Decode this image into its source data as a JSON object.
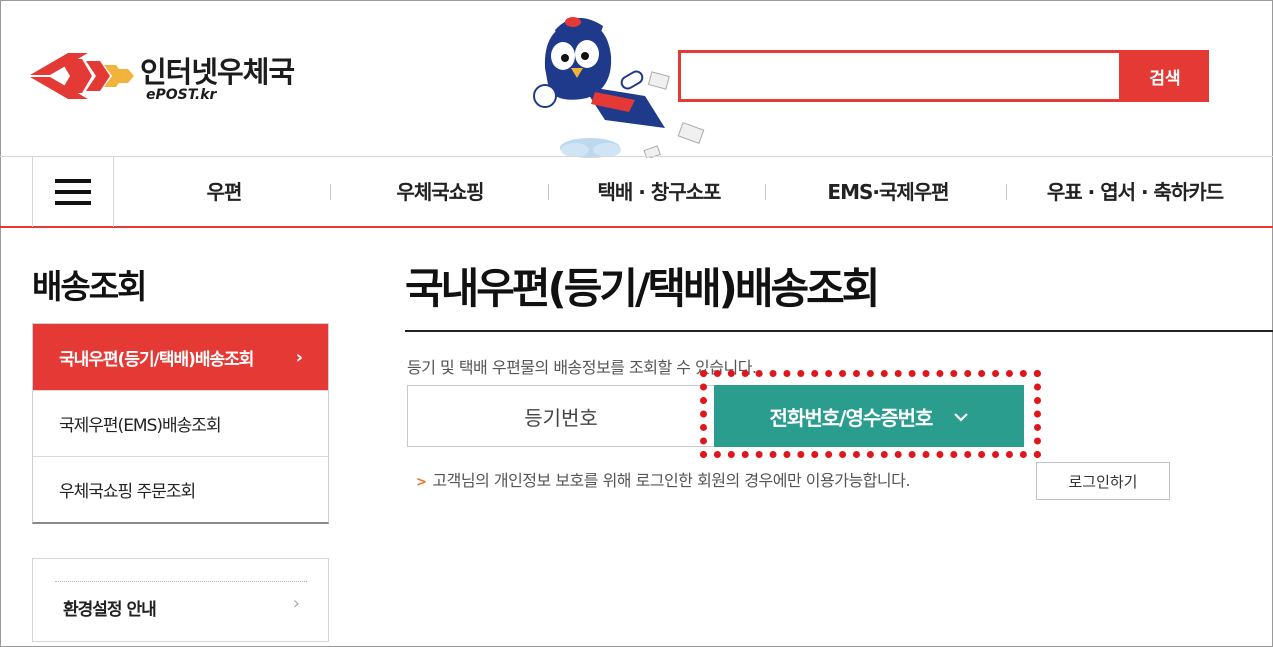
{
  "header": {
    "logo_title": "인터넷우체국",
    "logo_sub": "ePOST.kr",
    "search": {
      "value": "",
      "placeholder": "",
      "button_label": "검색"
    }
  },
  "nav": {
    "items": [
      "우편",
      "우체국쇼핑",
      "택배 · 창구소포",
      "EMS·국제우편",
      "우표 · 엽서 · 축하카드"
    ]
  },
  "sidebar": {
    "title": "배송조회",
    "items": [
      {
        "label": "국내우편(등기/택배)배송조회",
        "active": true
      },
      {
        "label": "국제우편(EMS)배송조회",
        "active": false
      },
      {
        "label": "우체국쇼핑 주문조회",
        "active": false
      }
    ],
    "settings_label": "환경설정 안내"
  },
  "main": {
    "title": "국내우편(등기/택배)배송조회",
    "description": "등기 및 택배 우편물의 배송정보를 조회할 수 있습니다.",
    "tabs": [
      {
        "label": "등기번호"
      },
      {
        "label": "전화번호/영수증번호"
      }
    ],
    "notice": "고객님의 개인정보 보호를 위해 로그인한 회원의 경우에만 이용가능합니다.",
    "login_button": "로그인하기"
  },
  "colors": {
    "brand_red": "#e53935",
    "teal": "#2a9d8f",
    "highlight": "#e0161d"
  }
}
